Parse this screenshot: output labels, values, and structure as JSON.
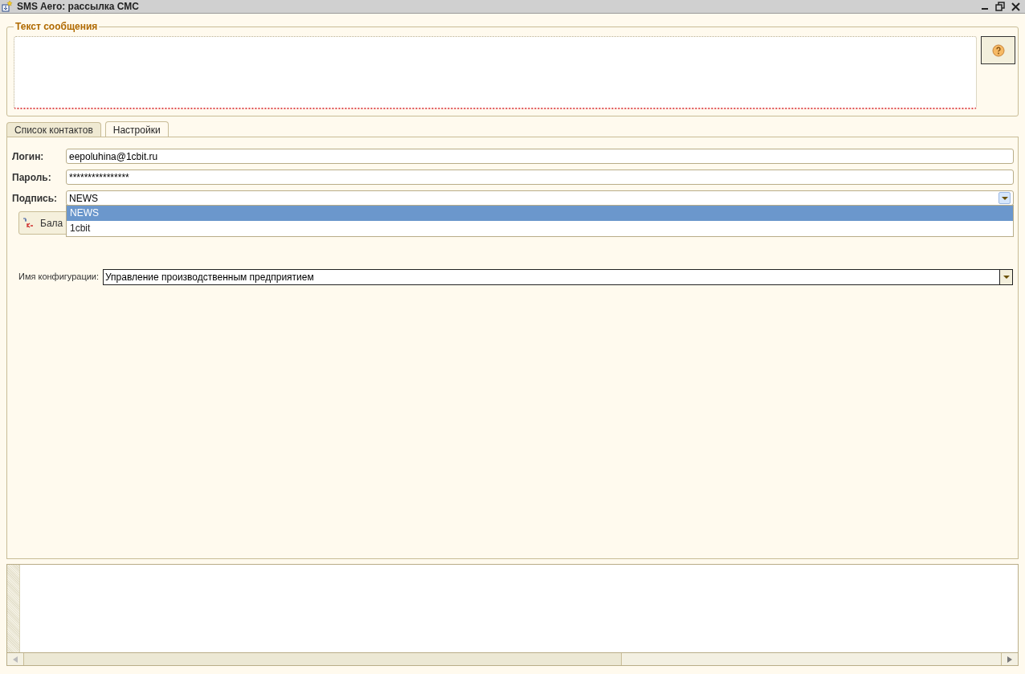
{
  "window": {
    "title": "SMS Aero: рассылка СМС"
  },
  "message": {
    "legend": "Текст сообщения",
    "invalid": true
  },
  "tabs": [
    {
      "label": "Список контактов",
      "selected": false
    },
    {
      "label": "Настройки",
      "selected": true
    }
  ],
  "settings": {
    "login": {
      "label": "Логин:",
      "value": "eepoluhina@1cbit.ru"
    },
    "password": {
      "label": "Пароль:",
      "value": "****************"
    },
    "signature": {
      "label": "Подпись:",
      "value": "NEWS",
      "expanded": true,
      "options": [
        {
          "label": "NEWS",
          "selected": true
        },
        {
          "label": "1cbit",
          "selected": false
        }
      ]
    },
    "balance_button": "Бала",
    "config": {
      "label": "Имя конфигурации:",
      "value": "Управление производственным предприятием"
    }
  }
}
